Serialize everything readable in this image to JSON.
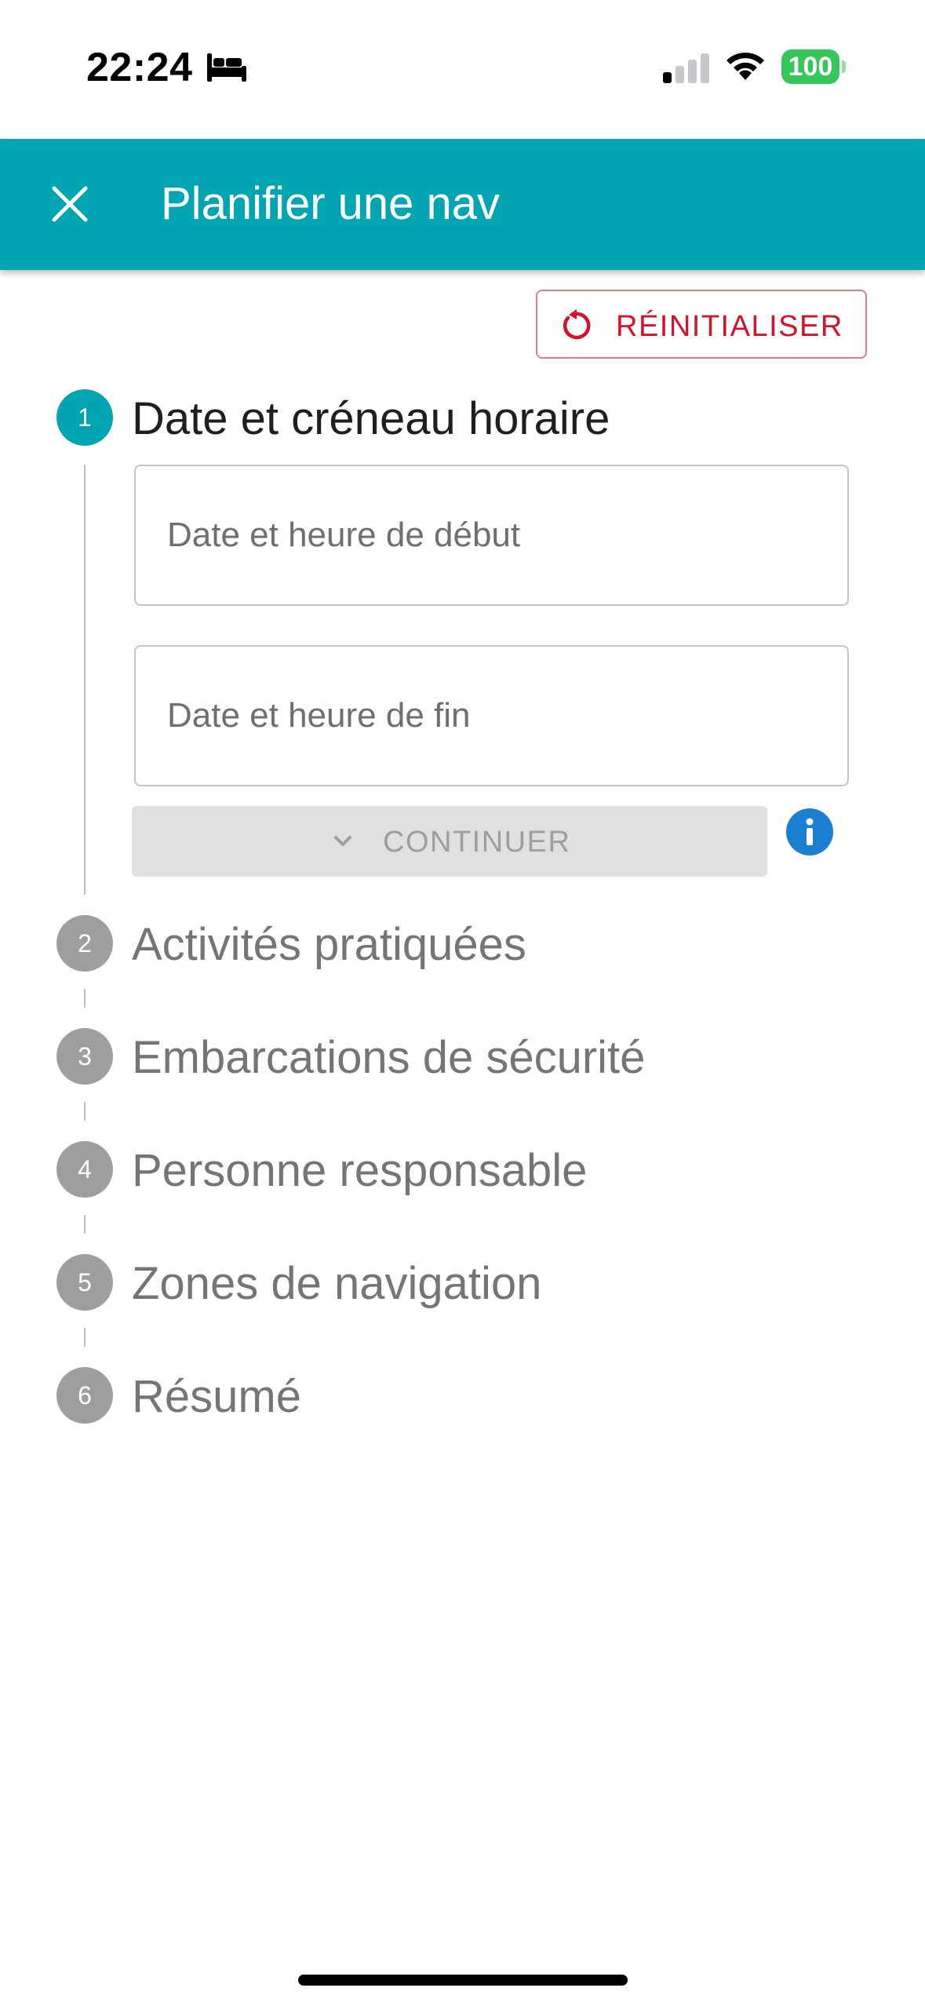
{
  "status_bar": {
    "time": "22:24",
    "battery": "100",
    "icons": [
      "bed-icon",
      "cellular-signal-icon",
      "wifi-icon",
      "battery-icon"
    ]
  },
  "app_bar": {
    "title": "Planifier une nav",
    "close_icon": "close-icon"
  },
  "reset_button": {
    "label": "RÉINITIALISER",
    "icon": "reset-icon",
    "color": "#d9102a"
  },
  "stepper": {
    "steps": [
      {
        "number": "1",
        "label": "Date et créneau horaire",
        "active": true
      },
      {
        "number": "2",
        "label": "Activités pratiquées",
        "active": false
      },
      {
        "number": "3",
        "label": "Embarcations de sécurité",
        "active": false
      },
      {
        "number": "4",
        "label": "Personne responsable",
        "active": false
      },
      {
        "number": "5",
        "label": "Zones de navigation",
        "active": false
      },
      {
        "number": "6",
        "label": "Résumé",
        "active": false
      }
    ]
  },
  "step1": {
    "start_field": {
      "placeholder": "Date et heure de début",
      "value": ""
    },
    "end_field": {
      "placeholder": "Date et heure de fin",
      "value": ""
    },
    "continue_label": "CONTINUER",
    "info_icon": "info-icon"
  },
  "colors": {
    "primary": "#00a5b2",
    "inactive_step": "#9e9e9e",
    "info": "#1a7fd1",
    "battery": "#34c759"
  }
}
